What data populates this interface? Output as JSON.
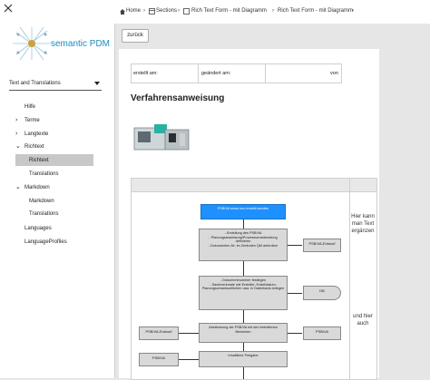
{
  "sidebar": {
    "logo_text": "semantic PDM",
    "language_select": "Text and Translations",
    "items": [
      {
        "label": "Hilfe"
      },
      {
        "label": "Terme"
      },
      {
        "label": "Langtexte"
      },
      {
        "label": "Richtext"
      },
      {
        "label": "Richtext"
      },
      {
        "label": "Translations"
      },
      {
        "label": "Markdown"
      },
      {
        "label": "Markdown"
      },
      {
        "label": "Translations"
      },
      {
        "label": "Languages"
      },
      {
        "label": "LanguageProfiles"
      }
    ]
  },
  "breadcrumb": {
    "home": "Home",
    "sections": "Sections",
    "rich1": "Rich Text Form - mit Diagramm",
    "rich2": "Rich Text Form - mit Diagramm"
  },
  "toolbar": {
    "back_label": "zurück"
  },
  "meta": {
    "created": "erstellt am:",
    "changed": "geändert am:",
    "by": "von"
  },
  "doc": {
    "title": "Verfahrensanweisung"
  },
  "flow": {
    "start": "PSB/VA muss neu erstellt werden",
    "step1": "- Erstellung des PSB/VA\n- Planungsanweisung/Prozessverantwortung definieren\n- Dokumenten-Nr. im Zentralen QM anfordern",
    "doc1": "PSB/VA-Entwurf",
    "step2": "- Dokumentnummer festlegen\n- Sachmerkmale wie Ersteller, Erstelldatum, Planungsverantwortlichen usw. in Datenbank anlegen",
    "db": "DB",
    "step3": "Abstimmung der PSB/VA mit den betroffenen Bereichen",
    "doc2": "PSB/VA-Entwurf",
    "doc3": "PSB/VA",
    "doc4": "PSB/VA",
    "step4": "Inhaltliche Freigabe",
    "note1": "Hier kann man Text ergänzen",
    "note2": "und hier auch"
  }
}
